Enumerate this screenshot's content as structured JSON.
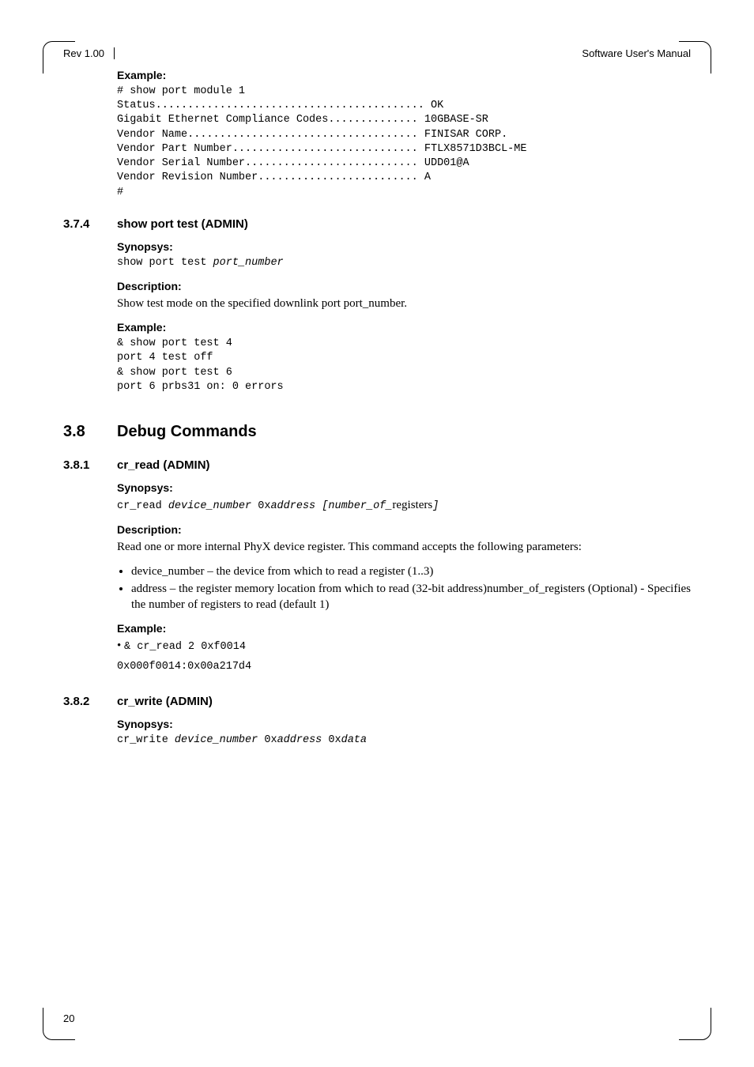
{
  "header": {
    "rev": "Rev 1.00",
    "title": "Software User's Manual"
  },
  "sec0": {
    "exampleLabel": "Example:",
    "lines": {
      "l1": "# show port module 1",
      "l2": "Status.......................................... OK",
      "l3": "Gigabit Ethernet Compliance Codes.............. 10GBASE-SR",
      "l4": "Vendor Name.................................... FINISAR CORP.",
      "l5": "Vendor Part Number............................. FTLX8571D3BCL-ME",
      "l6": "Vendor Serial Number........................... UDD01@A",
      "l7": "Vendor Revision Number......................... A",
      "l8": "#"
    }
  },
  "sec374": {
    "num": "3.7.4",
    "title": "show port test (ADMIN)",
    "synLabel": "Synopsys:",
    "synA": "show port test ",
    "synB": "port_number",
    "descLabel": "Description:",
    "desc": "Show test mode on the specified downlink port port_number.",
    "exLabel": "Example:",
    "ex": {
      "l1": "& show port test 4",
      "l2": "port 4 test off",
      "l3": "& show port test 6",
      "l4": "port 6 prbs31 on: 0 errors"
    }
  },
  "sec38": {
    "num": "3.8",
    "title": "Debug Commands"
  },
  "sec381": {
    "num": "3.8.1",
    "title": "cr_read (ADMIN)",
    "synLabel": "Synopsys:",
    "synA": "cr_read ",
    "synB": "device_number",
    "synC": " 0x",
    "synD": "address [number_of_",
    "synE": "registers",
    "synF": "]",
    "descLabel": "Description:",
    "desc": "Read one or more internal PhyX device register. This command accepts the following parameters:",
    "bul1": "device_number – the device from which to read a register (1..3)",
    "bul2": "address – the register memory location from which to read (32-bit address)number_of_registers (Optional) - Specifies the number of registers to read (default 1)",
    "exLabel": "Example:",
    "exA": "• ",
    "exB": "& cr_read 2 0xf0014",
    "exOut": "0x000f0014:0x00a217d4"
  },
  "sec382": {
    "num": "3.8.2",
    "title": "cr_write (ADMIN)",
    "synLabel": "Synopsys:",
    "synA": "cr_write ",
    "synB": "device_number",
    "synC": " 0x",
    "synD": "address",
    "synE": " 0x",
    "synF": "data"
  },
  "pageNumber": "20"
}
